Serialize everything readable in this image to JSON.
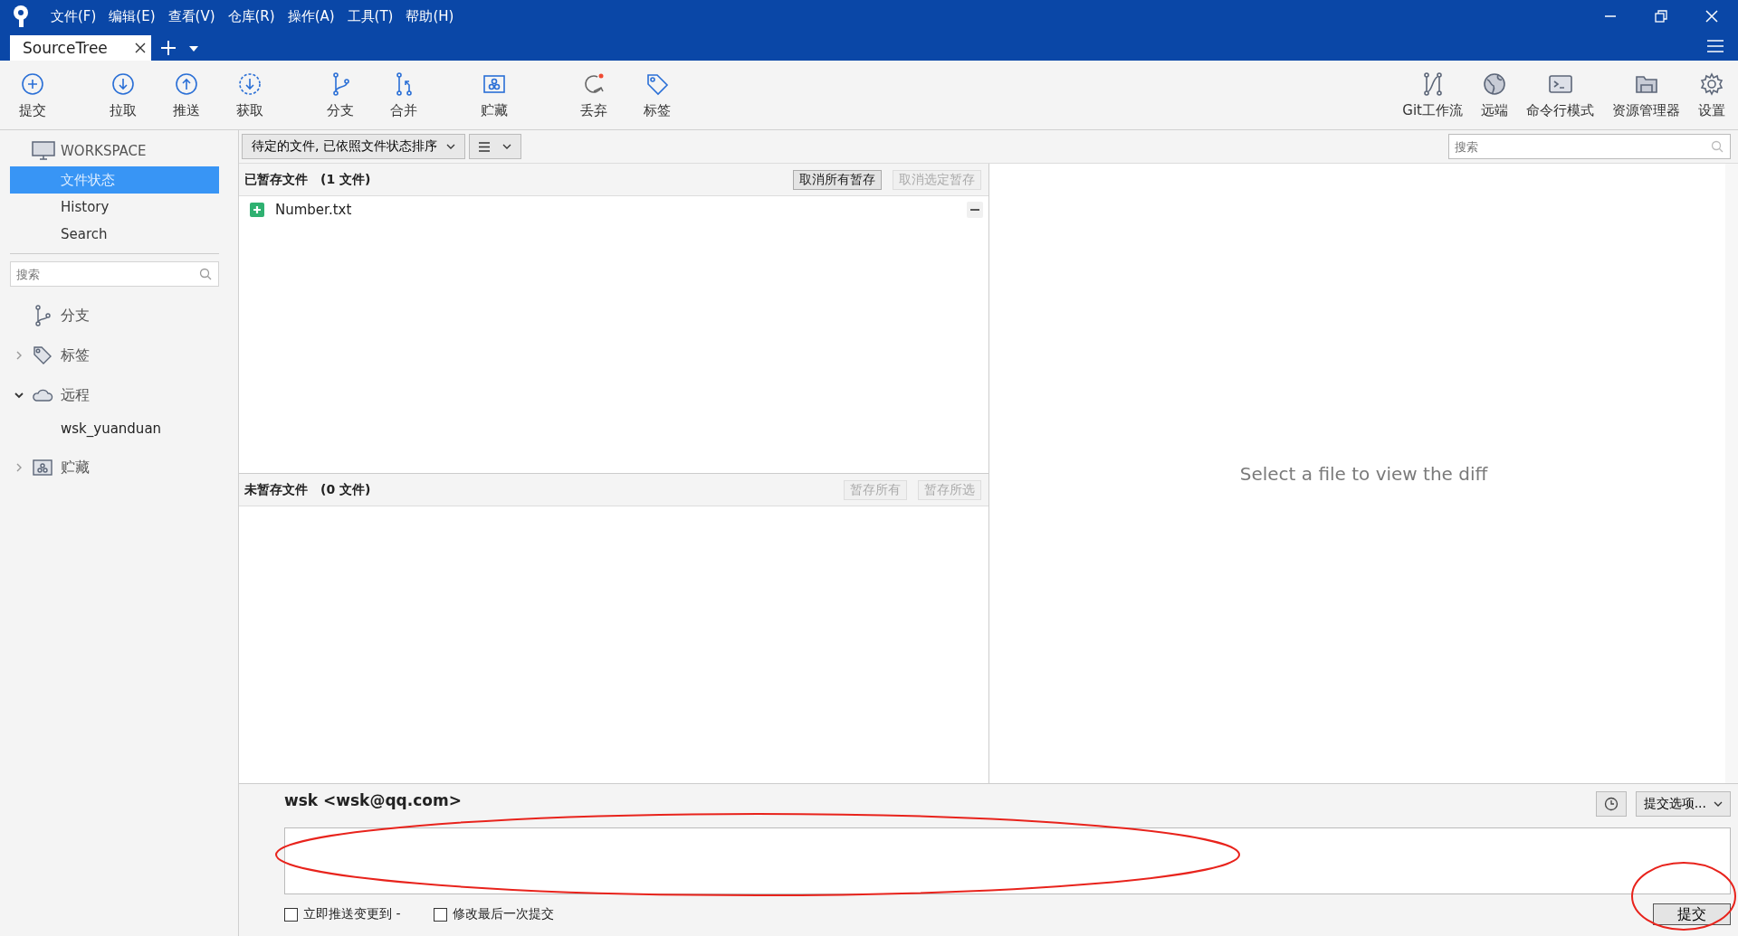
{
  "menu": [
    "文件(F)",
    "编辑(E)",
    "查看(V)",
    "仓库(R)",
    "操作(A)",
    "工具(T)",
    "帮助(H)"
  ],
  "tabs": [
    {
      "label": "SourceTree",
      "selected": true
    }
  ],
  "toolbar_left": [
    {
      "kind": "commit",
      "label": "提交"
    },
    {
      "kind": "pull",
      "label": "拉取"
    },
    {
      "kind": "push",
      "label": "推送"
    },
    {
      "kind": "fetch",
      "label": "获取"
    },
    {
      "kind": "branch",
      "label": "分支"
    },
    {
      "kind": "merge",
      "label": "合并"
    },
    {
      "kind": "stash",
      "label": "贮藏"
    },
    {
      "kind": "discard",
      "label": "丢弃"
    },
    {
      "kind": "tag",
      "label": "标签"
    }
  ],
  "toolbar_right": [
    {
      "kind": "gitflow",
      "label": "Git工作流"
    },
    {
      "kind": "remote",
      "label": "远端"
    },
    {
      "kind": "terminal",
      "label": "命令行模式"
    },
    {
      "kind": "explorer",
      "label": "资源管理器"
    },
    {
      "kind": "settings",
      "label": "设置"
    }
  ],
  "sidebar": {
    "workspace": "WORKSPACE",
    "items": [
      {
        "label": "文件状态",
        "selected": true
      },
      {
        "label": "History",
        "selected": false
      },
      {
        "label": "Search",
        "selected": false
      }
    ],
    "search": {
      "placeholder": "搜索"
    },
    "sections": [
      {
        "kind": "branch",
        "label": "分支"
      },
      {
        "kind": "tag",
        "label": "标签",
        "expanded": false
      },
      {
        "kind": "remote",
        "label": "远程",
        "expanded": true,
        "children": [
          {
            "label": "wsk_yuanduan"
          }
        ]
      },
      {
        "kind": "stash",
        "label": "贮藏",
        "expanded": false
      }
    ]
  },
  "filter": {
    "sort": "待定的文件, 已依照文件状态排序",
    "search": {
      "placeholder": "搜索"
    }
  },
  "staged": {
    "title": "已暂存文件",
    "count": "(1 文件)",
    "buttons": [
      {
        "label": "取消所有暂存",
        "disabled": false
      },
      {
        "label": "取消选定暂存",
        "disabled": true
      }
    ],
    "files": [
      {
        "name": "Number.txt",
        "kind": "added"
      }
    ]
  },
  "unstaged": {
    "title": "未暂存文件",
    "count": "(0 文件)",
    "buttons": [
      {
        "label": "暂存所有",
        "disabled": true
      },
      {
        "label": "暂存所选",
        "disabled": true
      }
    ]
  },
  "diff": {
    "placeholder": "Select a file to view the diff"
  },
  "commit": {
    "author": "wsk <wsk@qq.com>",
    "options": "提交选项...",
    "checkboxes": [
      {
        "label": "立即推送变更到 -",
        "checked": false
      },
      {
        "label": "修改最后一次提交",
        "checked": false
      }
    ],
    "submit": "提交"
  }
}
